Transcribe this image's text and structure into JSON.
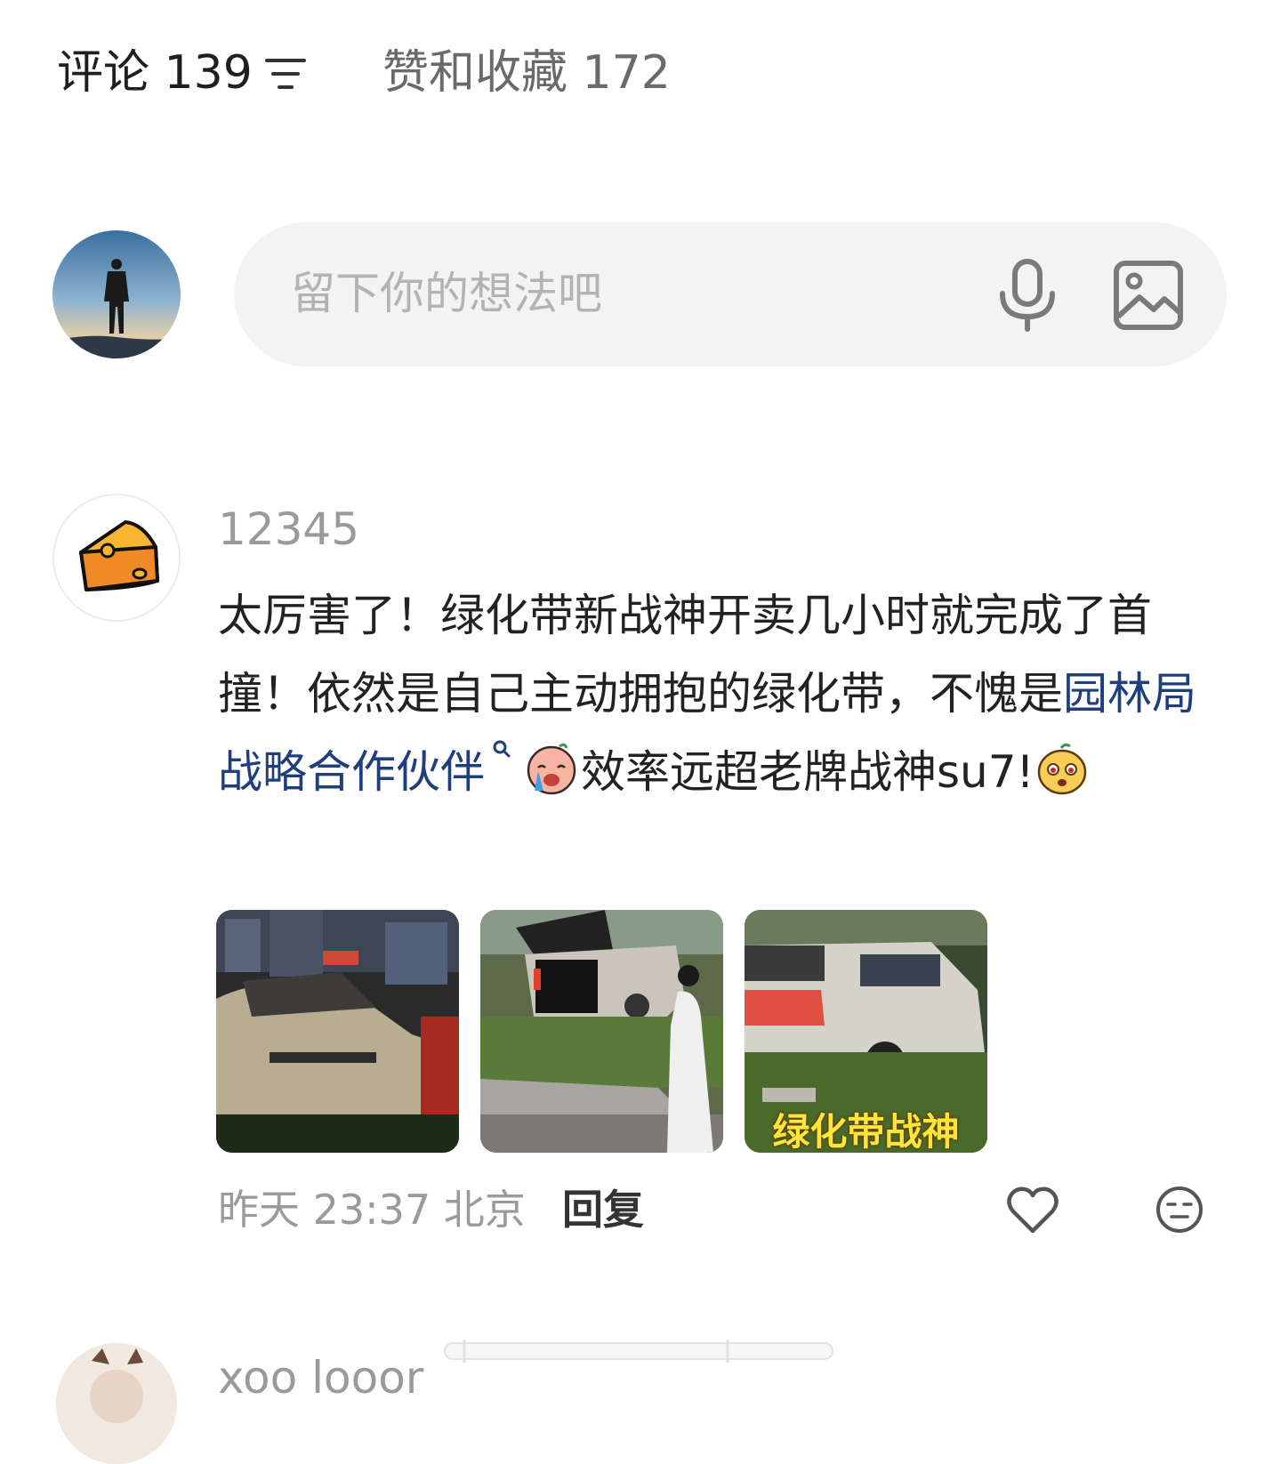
{
  "tabs": {
    "comments_label": "评论 139",
    "likes_label": "赞和收藏 172",
    "sort_icon": "sort-lines-icon"
  },
  "input": {
    "placeholder": "留下你的想法吧",
    "mic_icon": "microphone-icon",
    "image_icon": "image-icon"
  },
  "comment": {
    "username": "12345",
    "text_part1": "太厉害了！绿化带新战神开卖几小时就完成了首撞！依然是自己主动拥抱的绿化带，不愧是",
    "link_text": "园林局战略合作伙伴",
    "emoji_1": "crying-emoji",
    "text_part2": "效率远超老牌战神su7!",
    "emoji_2": "shocked-emoji",
    "images": [
      {
        "caption": ""
      },
      {
        "caption": ""
      },
      {
        "caption": "绿化带战神"
      }
    ],
    "time": "昨天 23:37 北京",
    "reply_label": "回复",
    "like_icon": "heart-icon",
    "dislike_icon": "meh-face-icon"
  },
  "next_comment": {
    "username": "xoo looor"
  },
  "colors": {
    "link": "#1e3f7b",
    "input_bg": "#f3f3f3",
    "muted_text": "#9a9a9a"
  }
}
